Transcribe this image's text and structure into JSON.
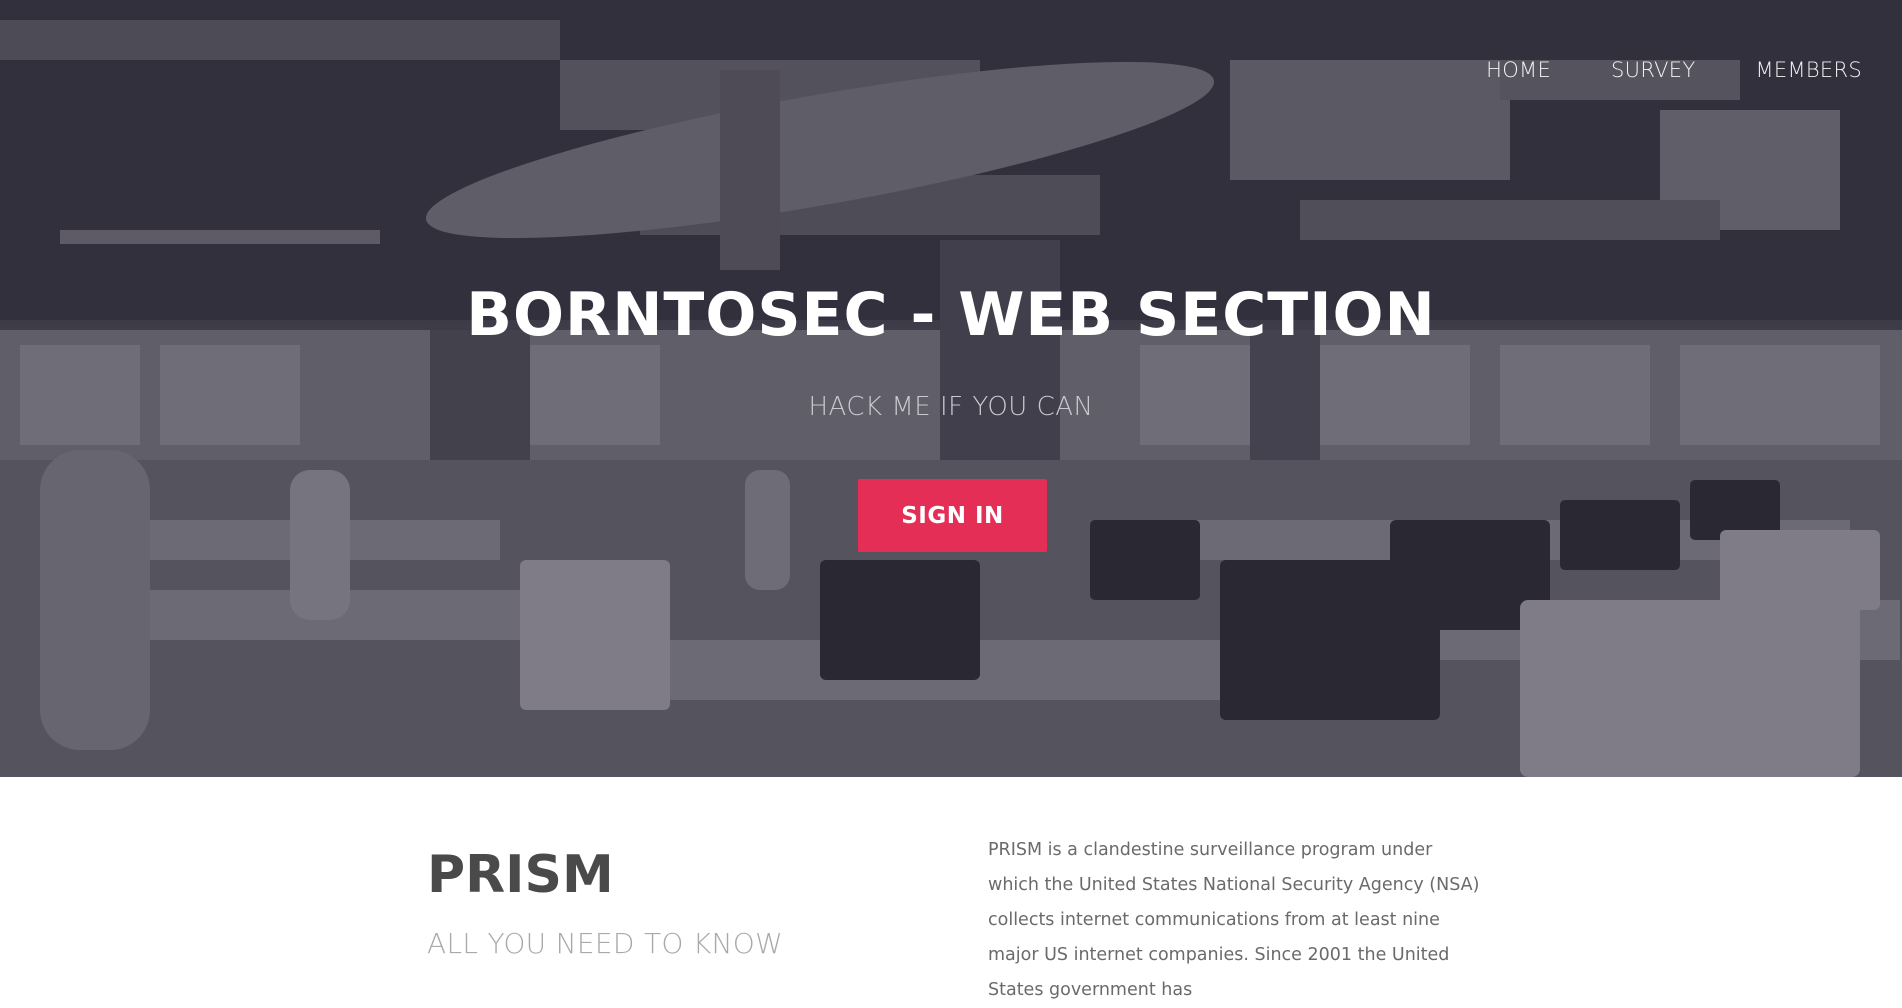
{
  "nav": {
    "items": [
      "HOME",
      "SURVEY",
      "MEMBERS"
    ]
  },
  "hero": {
    "title": "BORNTOSEC - WEB SECTION",
    "subtitle": "HACK ME IF YOU CAN",
    "cta_label": "SIGN IN"
  },
  "section": {
    "title": "PRISM",
    "subtitle": "ALL YOU NEED TO KNOW",
    "paragraph": "PRISM is a clandestine surveillance program under which the United States National Security Agency (NSA) collects internet communications from at least nine major US internet companies. Since 2001 the United States government has"
  },
  "colors": {
    "accent": "#e52e56",
    "overlay": "#3a3844"
  }
}
